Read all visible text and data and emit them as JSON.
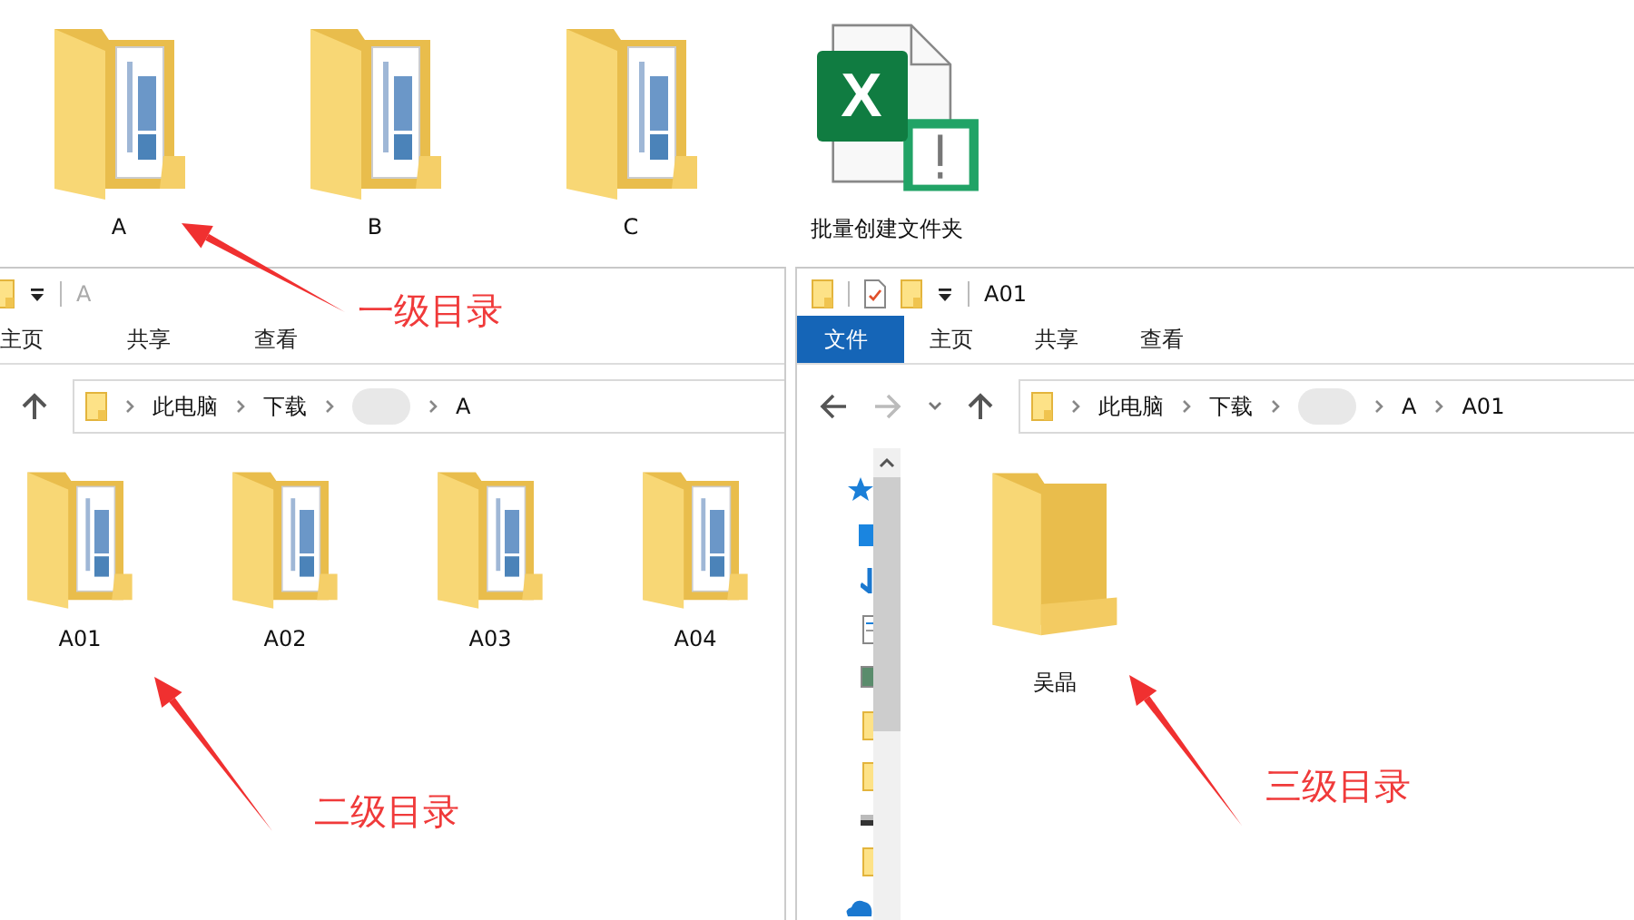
{
  "desktop": {
    "items": [
      {
        "kind": "folder",
        "label": "A"
      },
      {
        "kind": "folder",
        "label": "B"
      },
      {
        "kind": "folder",
        "label": "C"
      },
      {
        "kind": "excel",
        "label": "批量创建文件夹",
        "logo": "X"
      }
    ]
  },
  "windows": [
    {
      "title": "A",
      "active": false,
      "cropped": true,
      "tabs": [
        {
          "label": "主页",
          "selected": false
        },
        {
          "label": "共享",
          "selected": false
        },
        {
          "label": "查看",
          "selected": false
        }
      ],
      "path": [
        {
          "kind": "text",
          "text": "此电脑"
        },
        {
          "kind": "text",
          "text": "下载"
        },
        {
          "kind": "blurred"
        },
        {
          "kind": "text",
          "text": "A"
        }
      ],
      "items": [
        {
          "label": "A01"
        },
        {
          "label": "A02"
        },
        {
          "label": "A03"
        },
        {
          "label": "A04"
        }
      ]
    },
    {
      "title": "A01",
      "active": true,
      "cropped": false,
      "tabs": [
        {
          "label": "文件",
          "selected": true
        },
        {
          "label": "主页",
          "selected": false
        },
        {
          "label": "共享",
          "selected": false
        },
        {
          "label": "查看",
          "selected": false
        }
      ],
      "path": [
        {
          "kind": "text",
          "text": "此电脑"
        },
        {
          "kind": "text",
          "text": "下载"
        },
        {
          "kind": "blurred"
        },
        {
          "kind": "text",
          "text": "A"
        },
        {
          "kind": "text",
          "text": "A01"
        }
      ],
      "items": [
        {
          "label": "吴晶",
          "kind": "plain"
        }
      ]
    }
  ],
  "annotations": [
    {
      "text": "一级目录"
    },
    {
      "text": "二级目录"
    },
    {
      "text": "三级目录"
    }
  ]
}
